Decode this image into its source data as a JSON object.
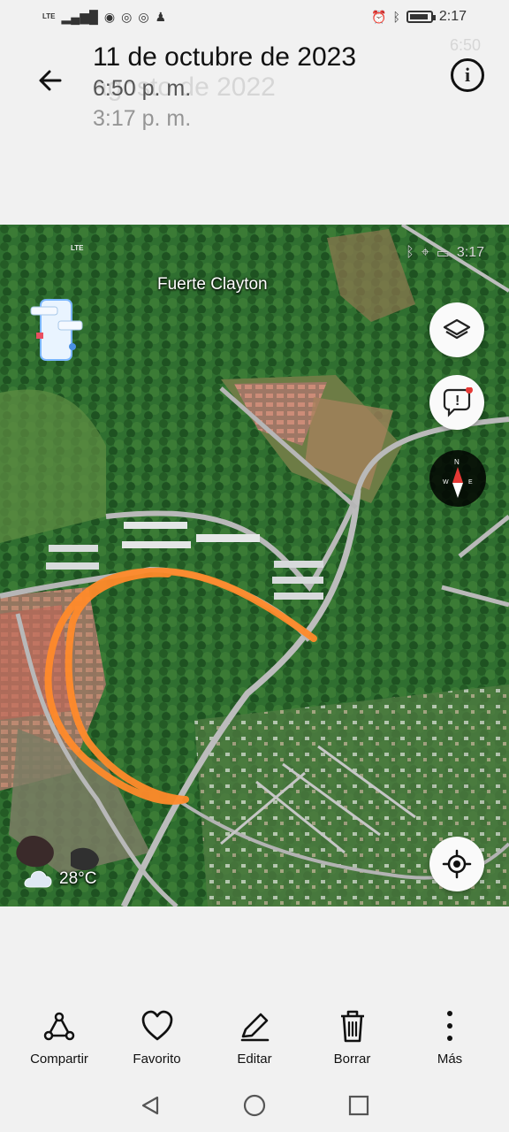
{
  "status_bar": {
    "lte": "LTE",
    "time": "2:17",
    "battery_level": 0.85
  },
  "header": {
    "date": "11 de octubre de 2023",
    "time": "6:50 p. m.",
    "overlay_date": "agosto de 2022",
    "overlay_time": "3:17 p. m.",
    "overlay_clock": "6:50"
  },
  "map": {
    "location_label": "Fuerte Clayton",
    "inner_status_time": "3:17",
    "inner_lte": "LTE",
    "weather_temp": "28°C",
    "compass_north": "N",
    "highlight_color": "#ff8a2a"
  },
  "actions": {
    "share": "Compartir",
    "favorite": "Favorito",
    "edit": "Editar",
    "delete": "Borrar",
    "more": "Más"
  },
  "icons": {
    "back": "back-arrow-icon",
    "info": "info-icon",
    "layers": "layers-icon",
    "feedback": "feedback-icon",
    "compass": "compass-icon",
    "location": "my-location-icon",
    "share": "share-icon",
    "favorite": "heart-icon",
    "edit": "pencil-icon",
    "delete": "trash-icon",
    "more": "more-vertical-icon"
  }
}
